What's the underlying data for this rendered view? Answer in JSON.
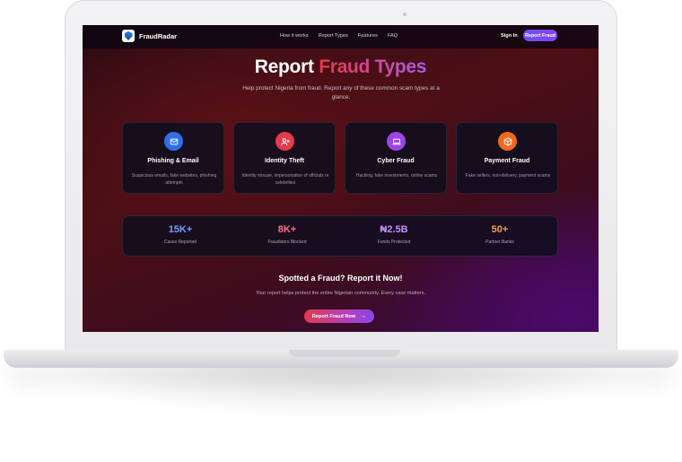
{
  "nav": {
    "brand": "FraudRadar",
    "links": [
      "How it works",
      "Report Types",
      "Features",
      "FAQ"
    ],
    "signin": "Sign In",
    "report_button": "Report Fraud"
  },
  "hero": {
    "title_plain": "Report ",
    "title_accent": "Fraud Types",
    "subtitle": "Help protect Nigeria from fraud. Report any of these common scam types at a glance."
  },
  "cards": [
    {
      "title": "Phishing & Email",
      "description": "Suspicious emails, fake websites, phishing attempts",
      "icon": "mail-icon",
      "color": "#2f6fe8"
    },
    {
      "title": "Identity Theft",
      "description": "Identity misuse, impersonation of officials or celebrities",
      "icon": "user-x-icon",
      "color": "#e23b4a"
    },
    {
      "title": "Cyber Fraud",
      "description": "Hacking, fake investments, online scams",
      "icon": "laptop-icon",
      "color": "#9a45e8"
    },
    {
      "title": "Payment Fraud",
      "description": "Fake sellers, non-delivery, payment scams",
      "icon": "box-icon",
      "color": "#f06a1e"
    }
  ],
  "stats": [
    {
      "value": "15K+",
      "label": "Cases Reported",
      "color": "#6fa0ff"
    },
    {
      "value": "8K+",
      "label": "Fraudsters Blocked",
      "color": "#ff6e8a"
    },
    {
      "value": "₦2.5B",
      "label": "Funds Protected",
      "color": "#c58cff"
    },
    {
      "value": "50+",
      "label": "Partner Banks",
      "color": "#ff9a4a"
    }
  ],
  "cta": {
    "title": "Spotted a Fraud? Report it Now!",
    "subtitle": "Your report helps protect the entire Nigerian community. Every case matters.",
    "button": "Report Fraud Now"
  }
}
